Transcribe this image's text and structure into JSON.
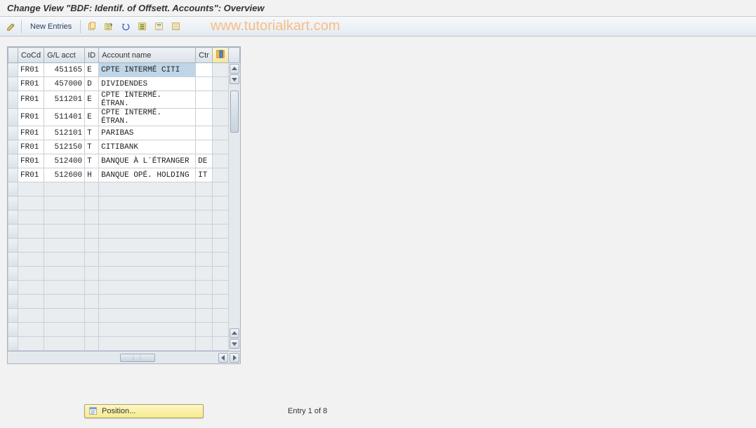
{
  "title": "Change View \"BDF: Identif. of Offsett. Accounts\": Overview",
  "watermark": "www.tutorialkart.com",
  "toolbar": {
    "new_entries_label": "New Entries",
    "icons": {
      "toggle": "toggle-display-change-icon",
      "copy": "copy-as-icon",
      "delete": "delete-icon",
      "undo": "undo-change-icon",
      "select_all": "select-all-icon",
      "select_block": "select-block-icon",
      "deselect_all": "deselect-all-icon"
    }
  },
  "grid": {
    "columns": {
      "cocd": "CoCd",
      "glacct": "G/L acct",
      "id": "ID",
      "acctname": "Account name",
      "ctr": "Ctr"
    },
    "rows": [
      {
        "cocd": "FR01",
        "glacct": "451165",
        "id": "E",
        "acctname": "CPTE INTERMÉ CITI",
        "ctr": "",
        "selected": true
      },
      {
        "cocd": "FR01",
        "glacct": "457000",
        "id": "D",
        "acctname": "DIVIDENDES",
        "ctr": ""
      },
      {
        "cocd": "FR01",
        "glacct": "511201",
        "id": "E",
        "acctname": "CPTE INTERMÉ. ÉTRAN.",
        "ctr": ""
      },
      {
        "cocd": "FR01",
        "glacct": "511401",
        "id": "E",
        "acctname": "CPTE INTERMÉ. ÉTRAN.",
        "ctr": ""
      },
      {
        "cocd": "FR01",
        "glacct": "512101",
        "id": "T",
        "acctname": "PARIBAS",
        "ctr": ""
      },
      {
        "cocd": "FR01",
        "glacct": "512150",
        "id": "T",
        "acctname": "CITIBANK",
        "ctr": ""
      },
      {
        "cocd": "FR01",
        "glacct": "512400",
        "id": "T",
        "acctname": "BANQUE À L´ÉTRANGER",
        "ctr": "DE"
      },
      {
        "cocd": "FR01",
        "glacct": "512600",
        "id": "H",
        "acctname": "BANQUE OPÉ. HOLDING",
        "ctr": "IT"
      }
    ],
    "empty_rows": 12
  },
  "footer": {
    "position_label": "Position...",
    "status": "Entry 1 of 8"
  },
  "colors": {
    "accent_orange": "#ff9a3c",
    "highlight_yellow": "#f7eb8e"
  }
}
